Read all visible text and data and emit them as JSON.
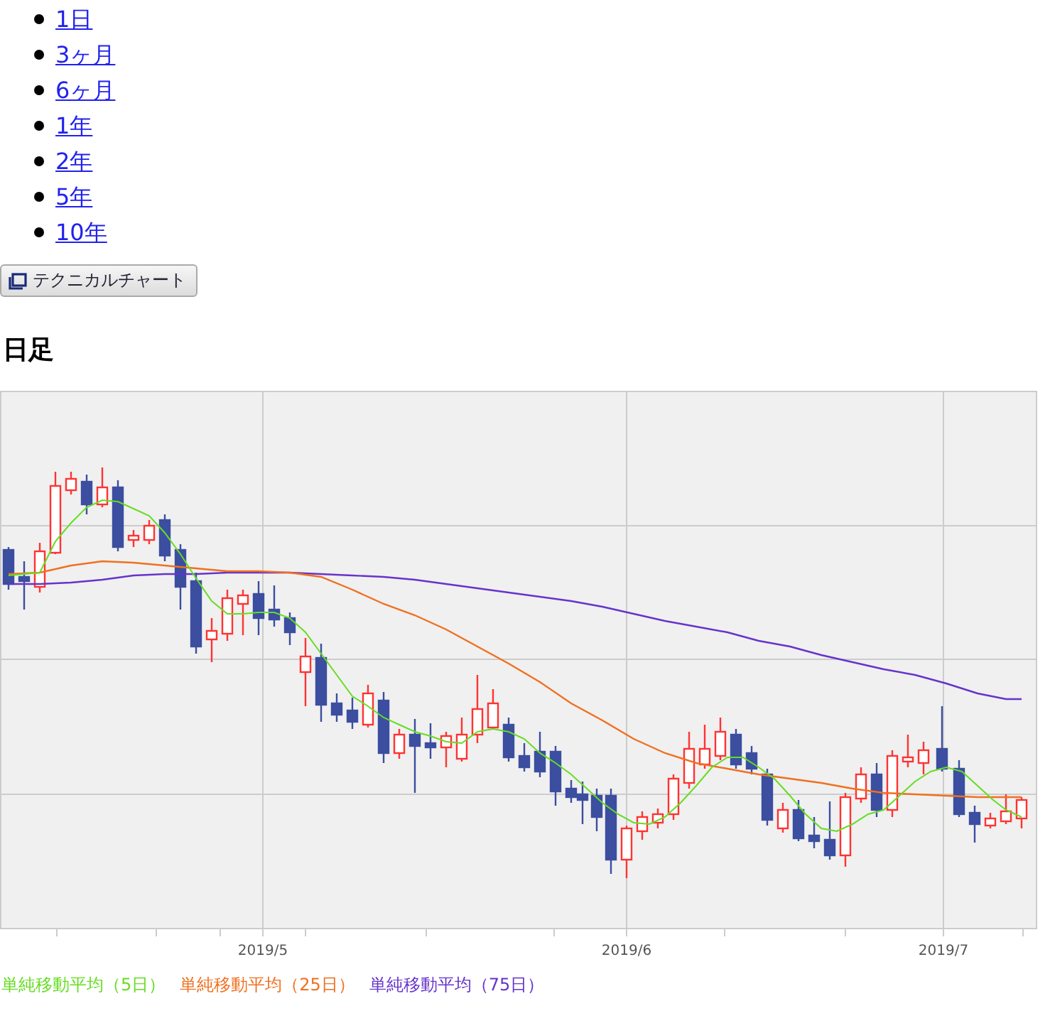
{
  "periods": [
    {
      "label": "1日"
    },
    {
      "label": "3ヶ月"
    },
    {
      "label": "6ヶ月"
    },
    {
      "label": "1年"
    },
    {
      "label": "2年"
    },
    {
      "label": "5年"
    },
    {
      "label": "10年"
    }
  ],
  "technical_button": {
    "label": "テクニカルチャート"
  },
  "section_title": "日足",
  "chart": {
    "x_labels": [
      "2019/5",
      "2019/6",
      "2019/7"
    ]
  },
  "legend": [
    {
      "label": "単純移動平均（5日）",
      "color": "#66dd22"
    },
    {
      "label": "単純移動平均（25日）",
      "color": "#f07020"
    },
    {
      "label": "単純移動平均（75日）",
      "color": "#6633cc"
    }
  ]
}
